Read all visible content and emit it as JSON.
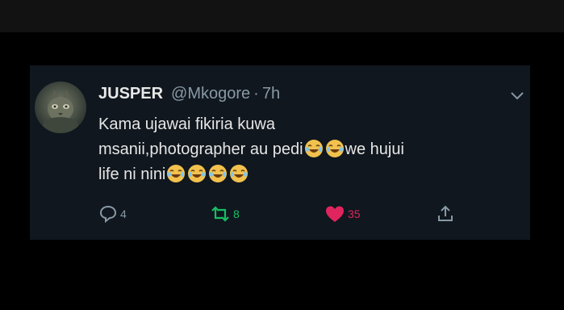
{
  "tweet": {
    "display_name": "JUSPER",
    "handle": "@Mkogore",
    "separator": "·",
    "time": "7h",
    "text_line1": "Kama ujawai fikiria kuwa",
    "text_line2": "msanii,photographer au pedi",
    "text_line2_tail": "we hujui",
    "text_line3": "life ni nini"
  },
  "actions": {
    "reply_count": "4",
    "retweet_count": "8",
    "like_count": "35"
  },
  "colors": {
    "background": "#000000",
    "card": "#10171e",
    "name": "#e8e8e8",
    "muted": "#8899a6",
    "retweet": "#17bf63",
    "like": "#e0245e"
  },
  "icons": {
    "reply": "reply-icon",
    "retweet": "retweet-icon",
    "like": "heart-icon",
    "share": "share-icon",
    "menu": "chevron-down-icon",
    "emoji": "face-with-tears-of-joy-emoji"
  }
}
